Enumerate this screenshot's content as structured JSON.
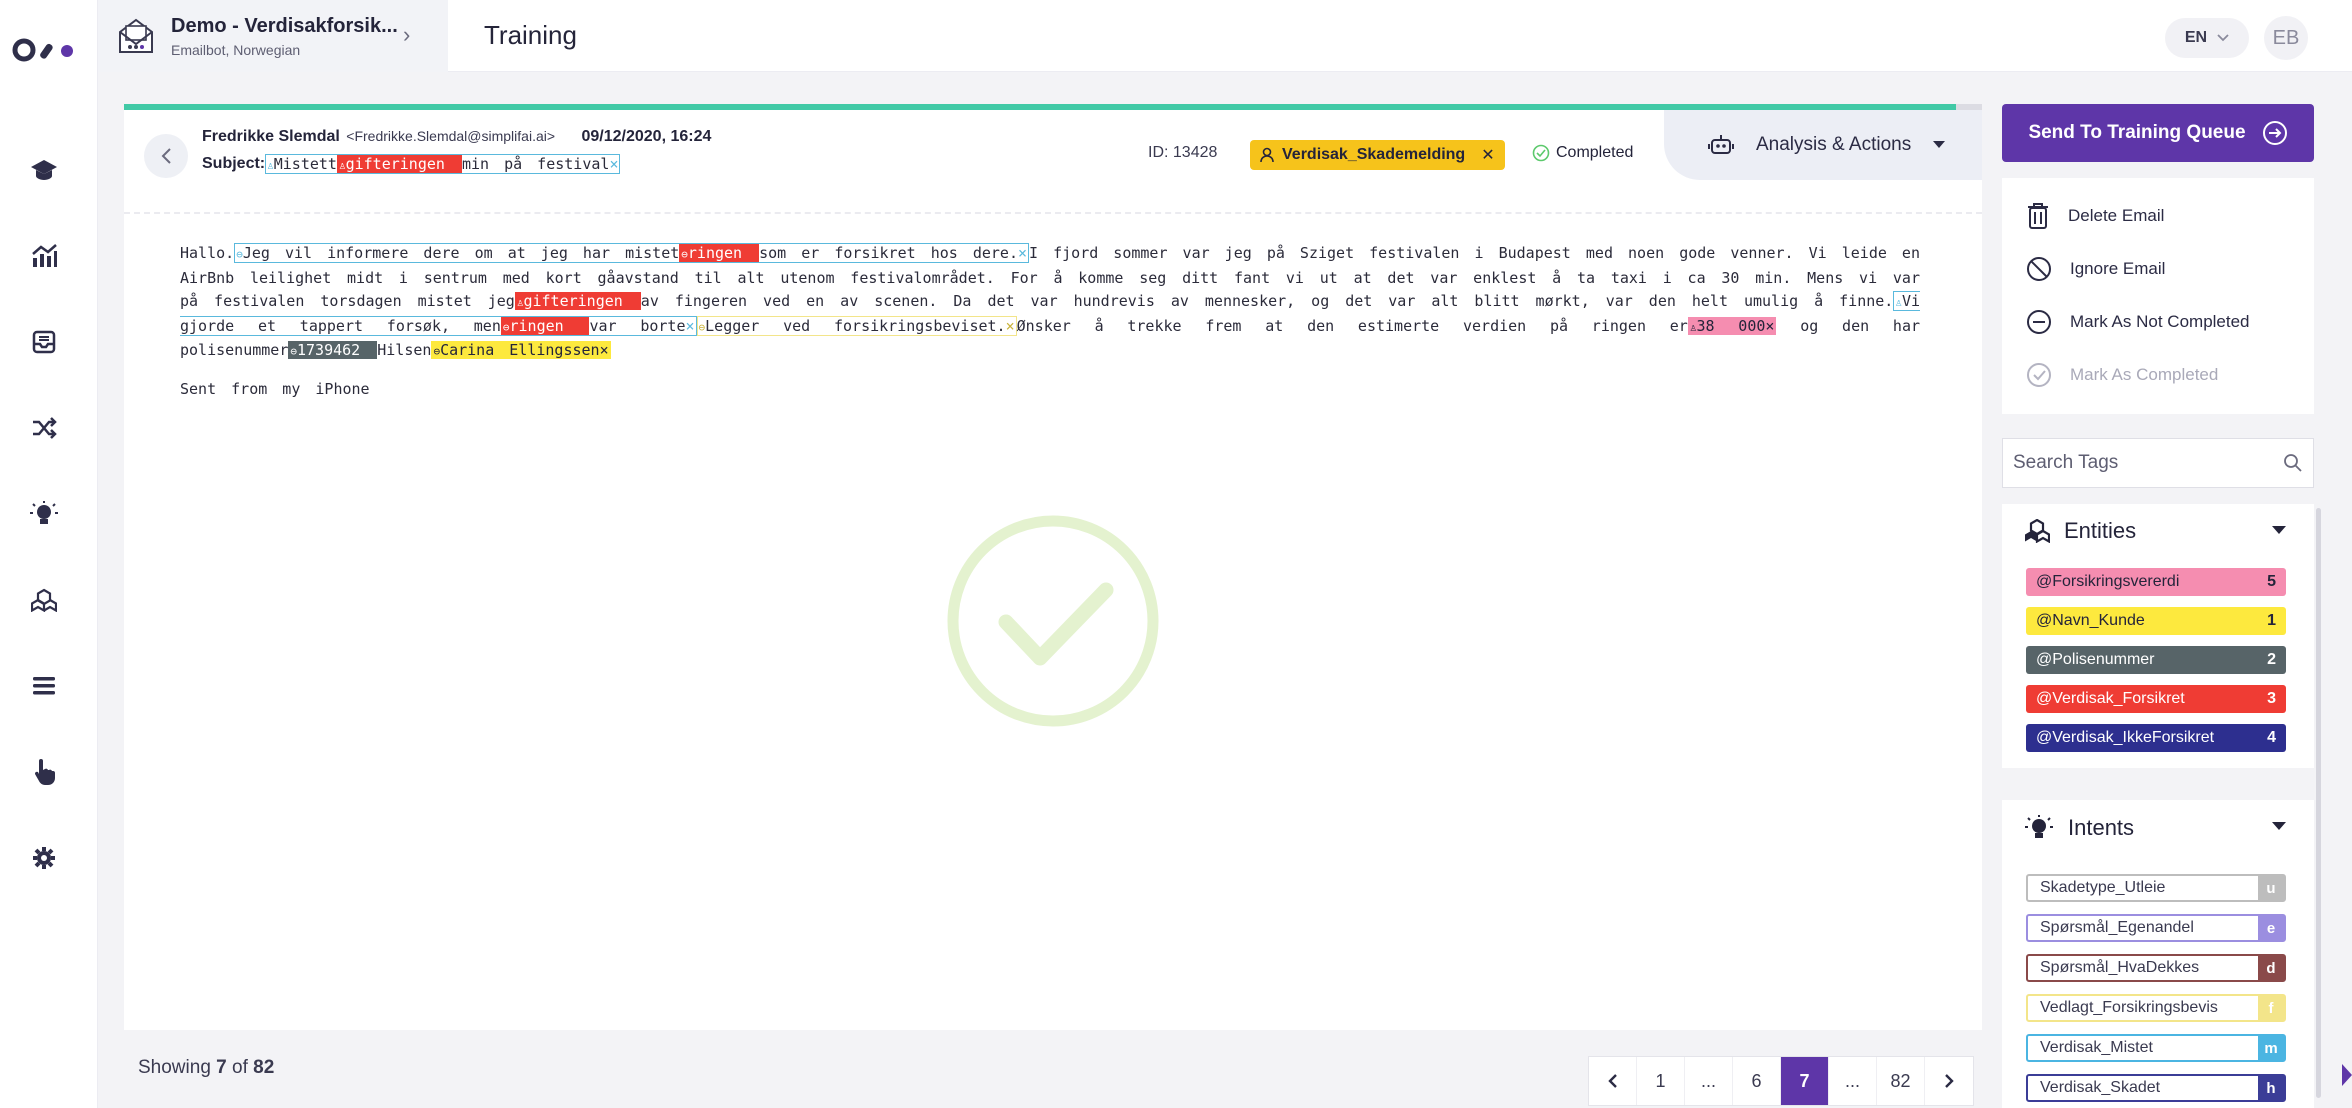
{
  "colors": {
    "brand": "#5e36a8",
    "progress": "#41c9a6",
    "intent_badge": "#f6c31b",
    "completed": "#5cc96c"
  },
  "nav": {
    "items": [
      "logo",
      "graduation-cap-icon",
      "analytics-icon",
      "inbox-icon",
      "shuffle-icon",
      "lightbulb-icon",
      "entities-icon",
      "list-icon",
      "pointer-hand-icon",
      "settings-icon"
    ]
  },
  "topbar": {
    "project_name": "Demo - Verdisakforsik...",
    "project_sub": "Emailbot, Norwegian",
    "page_title": "Training",
    "language": "EN",
    "avatar": "EB"
  },
  "email": {
    "progress": 0.986,
    "sender_name": "Fredrikke Slemdal",
    "sender_email": "<Fredrikke.Slemdal@simplifai.ai>",
    "date": "09/12/2020, 16:24",
    "subject_label": "Subject:",
    "subject_parts": {
      "s1": "Mistett",
      "t1": "gifteringen",
      "s2": "min på festival",
      "x": "×"
    },
    "id_label": "ID: 13428",
    "intent_badge": "Verdisak_Skademelding",
    "intent_badge_close": "✕",
    "status": "Completed",
    "analysis_label": "Analysis & Actions",
    "body": {
      "p0": "Hallo.",
      "s1a": "Jeg vil informere dere om at jeg har mistet",
      "t_ringen1": "ringen",
      "s1b": " som er forsikret hos dere.",
      "p1": "I fjord sommer var jeg på Sziget festivalen i Budapest med noen gode venner. Vi leide en AirBnb leilighet midt i sentrum med kort gåavstand til alt utenom festivalområdet. For å komme seg ditt fant vi ut at det var enklest å ta taxi i ca 30 min. Mens vi var på festivalen torsdagen mistet jeg",
      "t_gift2": "gifteringen",
      "p2": " av fingeren ved en av scenen. Da det var hundrevis av mennesker, og det var alt blitt mørkt, var den helt umulig å finne.",
      "s2a": "Vi gjorde et tappert forsøk, men",
      "t_ringen2": "ringen",
      "s2b": " var borte",
      "s3": "Legger ved forsikringsbeviset.",
      "p3": "Ønsker å trekke frem at den estimerte verdien på ringen er",
      "t_value": "38 000",
      "p4": " og den har polisenummer",
      "t_polise": "1739462",
      "p5": " Hilsen",
      "t_name": "Carina Ellingssen",
      "x": "×",
      "signature": "Sent from my iPhone"
    }
  },
  "footer": {
    "showing_prefix": "Showing ",
    "showing_current": "7",
    "showing_mid": " of ",
    "showing_total": "82",
    "pages": [
      "1",
      "...",
      "6",
      "7",
      "...",
      "82"
    ],
    "active_page": "7"
  },
  "right": {
    "send_button": "Send To Training Queue",
    "actions": [
      "Delete Email",
      "Ignore Email",
      "Mark As Not Completed",
      "Mark As Completed"
    ],
    "search_placeholder": "Search Tags",
    "entities_title": "Entities",
    "entities": [
      {
        "name": "@Forsikringsvererdi",
        "count": "5",
        "color": "#f58db0",
        "text": "#24243a"
      },
      {
        "name": "@Navn_Kunde",
        "count": "1",
        "color": "#fde93e",
        "text": "#24243a"
      },
      {
        "name": "@Polisenummer",
        "count": "2",
        "color": "#576468",
        "text": "#ffffff"
      },
      {
        "name": "@Verdisak_Forsikret",
        "count": "3",
        "color": "#ef3c34",
        "text": "#ffffff"
      },
      {
        "name": "@Verdisak_IkkeForsikret",
        "count": "4",
        "color": "#2d2f8f",
        "text": "#ffffff"
      }
    ],
    "intents_title": "Intents",
    "intents": [
      {
        "name": "Skadetype_Utleie",
        "key": "u",
        "color": "#bdbdbd"
      },
      {
        "name": "Spørsmål_Egenandel",
        "key": "e",
        "color": "#9b8ee0"
      },
      {
        "name": "Spørsmål_HvaDekkes",
        "key": "d",
        "color": "#8a4a4a"
      },
      {
        "name": "Vedlagt_Forsikringsbevis",
        "key": "f",
        "color": "#f3e58a"
      },
      {
        "name": "Verdisak_Mistet",
        "key": "m",
        "color": "#4bb5e2"
      },
      {
        "name": "Verdisak_Skadet",
        "key": "h",
        "color": "#3b3d97"
      }
    ]
  }
}
